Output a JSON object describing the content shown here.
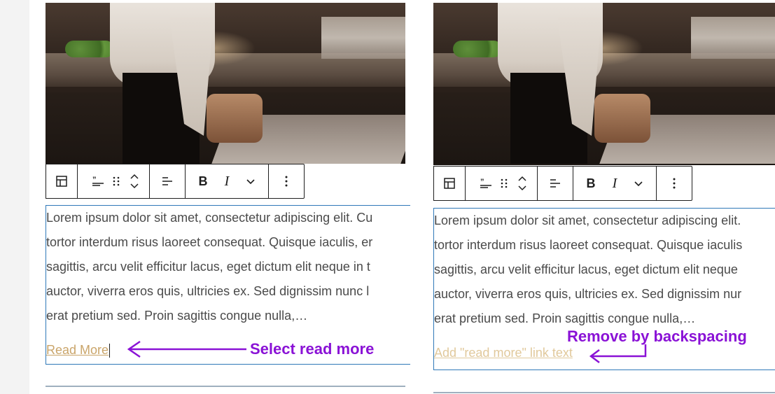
{
  "colors": {
    "accent_purple": "#8a12d6",
    "selection_blue": "#2f78b8",
    "link_gold": "#caa56a",
    "placeholder_gold": "#e1c99c",
    "text_gray": "#4a4a4a"
  },
  "toolbar": {
    "icons": [
      "block-layout-icon",
      "quote-icon",
      "drag-handle-icon",
      "move-up-down-icon",
      "align-icon",
      "bold-icon",
      "italic-icon",
      "more-formatting-icon",
      "options-icon"
    ],
    "bold_label": "B",
    "italic_label": "I",
    "more_label": "⌄",
    "options_label": "⋮"
  },
  "left": {
    "lines": [
      "Lorem ipsum dolor sit amet, consectetur adipiscing elit. Cu",
      "tortor interdum risus laoreet consequat. Quisque iaculis, er",
      "sagittis, arcu velit efficitur lacus, eget dictum elit neque in t",
      "auctor, viverra eros quis, ultricies ex. Sed dignissim nunc l",
      "erat pretium sed. Proin sagittis congue nulla,…"
    ],
    "link_text": "Read More",
    "annotation": "Select read more"
  },
  "right": {
    "lines": [
      "Lorem ipsum dolor sit amet, consectetur adipiscing elit.",
      "tortor interdum risus laoreet consequat. Quisque iaculis",
      "sagittis, arcu velit efficitur lacus, eget dictum elit neque",
      "auctor, viverra eros quis, ultricies ex. Sed dignissim nur",
      "erat pretium sed. Proin sagittis congue nulla,…"
    ],
    "link_placeholder": "Add \"read more\" link text",
    "annotation": "Remove by backspacing"
  }
}
